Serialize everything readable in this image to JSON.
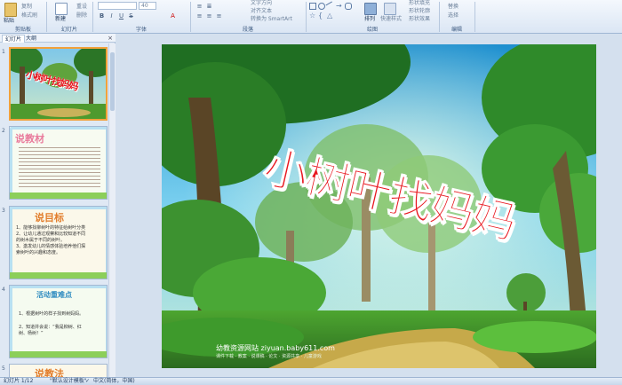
{
  "ribbon": {
    "groups": {
      "clipboard": "剪贴板",
      "slides": "幻灯片",
      "font": "字体",
      "paragraph": "段落",
      "drawing": "绘图",
      "editing": "编辑"
    },
    "paste_label": "粘贴",
    "clear_label": "复制",
    "format_label": "格式刷",
    "new_slide_label": "新建",
    "new_slide_sub": "幻灯片",
    "reset_label": "重设",
    "delete_label": "删除",
    "font_size": "40",
    "text_direction": "文字方向",
    "align_text": "对齐文本",
    "smartart": "转换为 SmartArt",
    "arrange_label": "排列",
    "quick_styles": "快速样式",
    "shape_fill": "形状填充",
    "shape_outline": "形状轮廓",
    "shape_effects": "形状效果",
    "replace_label": "替换",
    "select_label": "选择"
  },
  "panel": {
    "tab_slides": "幻灯片",
    "tab_outline": "大纲",
    "close_glyph": "×"
  },
  "thumbnails": [
    {
      "num": "1",
      "title": "小树叶找妈妈"
    },
    {
      "num": "2",
      "title": "说教材"
    },
    {
      "num": "3",
      "title": "说目标",
      "lines": [
        "1、能够找柳树叶的特征给树叶分类",
        "2、让幼儿通过观察和比较知道不同",
        "的树木属于不同的树叶。",
        "3、激发幼儿的情感体验培养他们探",
        "索树叶的兴趣和态度。"
      ]
    },
    {
      "num": "4",
      "title": "活动重难点",
      "lines": [
        "1、根据树叶的样子找到树妈妈。",
        "2、知道并会说：“我是柳树、红",
        "树、杨树！”"
      ]
    },
    {
      "num": "5",
      "title": "说教法"
    }
  ],
  "slide": {
    "title": "小树叶找妈妈",
    "watermark_line1": "幼教资源网站 ziyuan.baby611.com",
    "watermark_line2": "课件下载 · 教案 · 说课稿 · 论文 · 资源共享 · 儿童游戏"
  },
  "status": {
    "slide_counter": "幻灯片 1/12",
    "theme": "\"默认设计模板\"",
    "language": "中文(简体，中国)"
  },
  "colors": {
    "title_red": "#e8171f",
    "title_outline": "#ffffff",
    "ribbon_bg": "#dbe6f4",
    "selection": "#f2a13a"
  }
}
